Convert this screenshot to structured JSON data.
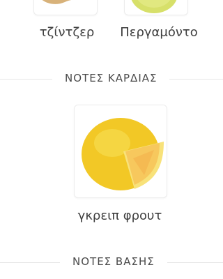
{
  "top_notes": [
    {
      "name": "τζίντζερ",
      "icon": "ginger-icon"
    },
    {
      "name": "Περγαμόντο",
      "icon": "bergamot-icon"
    }
  ],
  "heart_notes": {
    "title": "ΝΟΤΕΣ ΚΑΡΔΙΑΣ",
    "items": [
      {
        "name": "γκρειπ φρουτ",
        "icon": "grapefruit-icon"
      }
    ]
  },
  "base_notes": {
    "title": "ΝΟΤΕΣ ΒΑΣΗΣ"
  }
}
